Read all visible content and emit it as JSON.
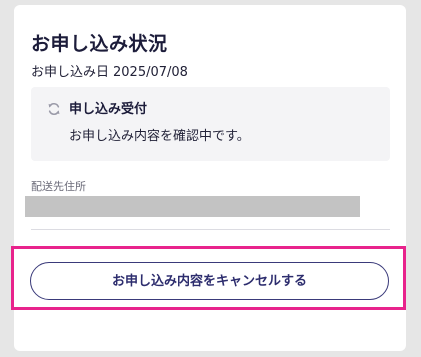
{
  "page": {
    "title": "お申し込み状況"
  },
  "application": {
    "date_label": "お申し込み日",
    "date_value": "2025/07/08"
  },
  "status": {
    "icon": "refresh-icon",
    "title": "申し込み受付",
    "description": "お申し込み内容を確認中です。"
  },
  "shipping": {
    "label": "配送先住所"
  },
  "actions": {
    "cancel_label": "お申し込み内容をキャンセルする"
  },
  "colors": {
    "highlight": "#e8238c",
    "button_border": "#3a3a7a",
    "status_bg": "#f4f4f6",
    "redaction": "#c3c3c3"
  }
}
